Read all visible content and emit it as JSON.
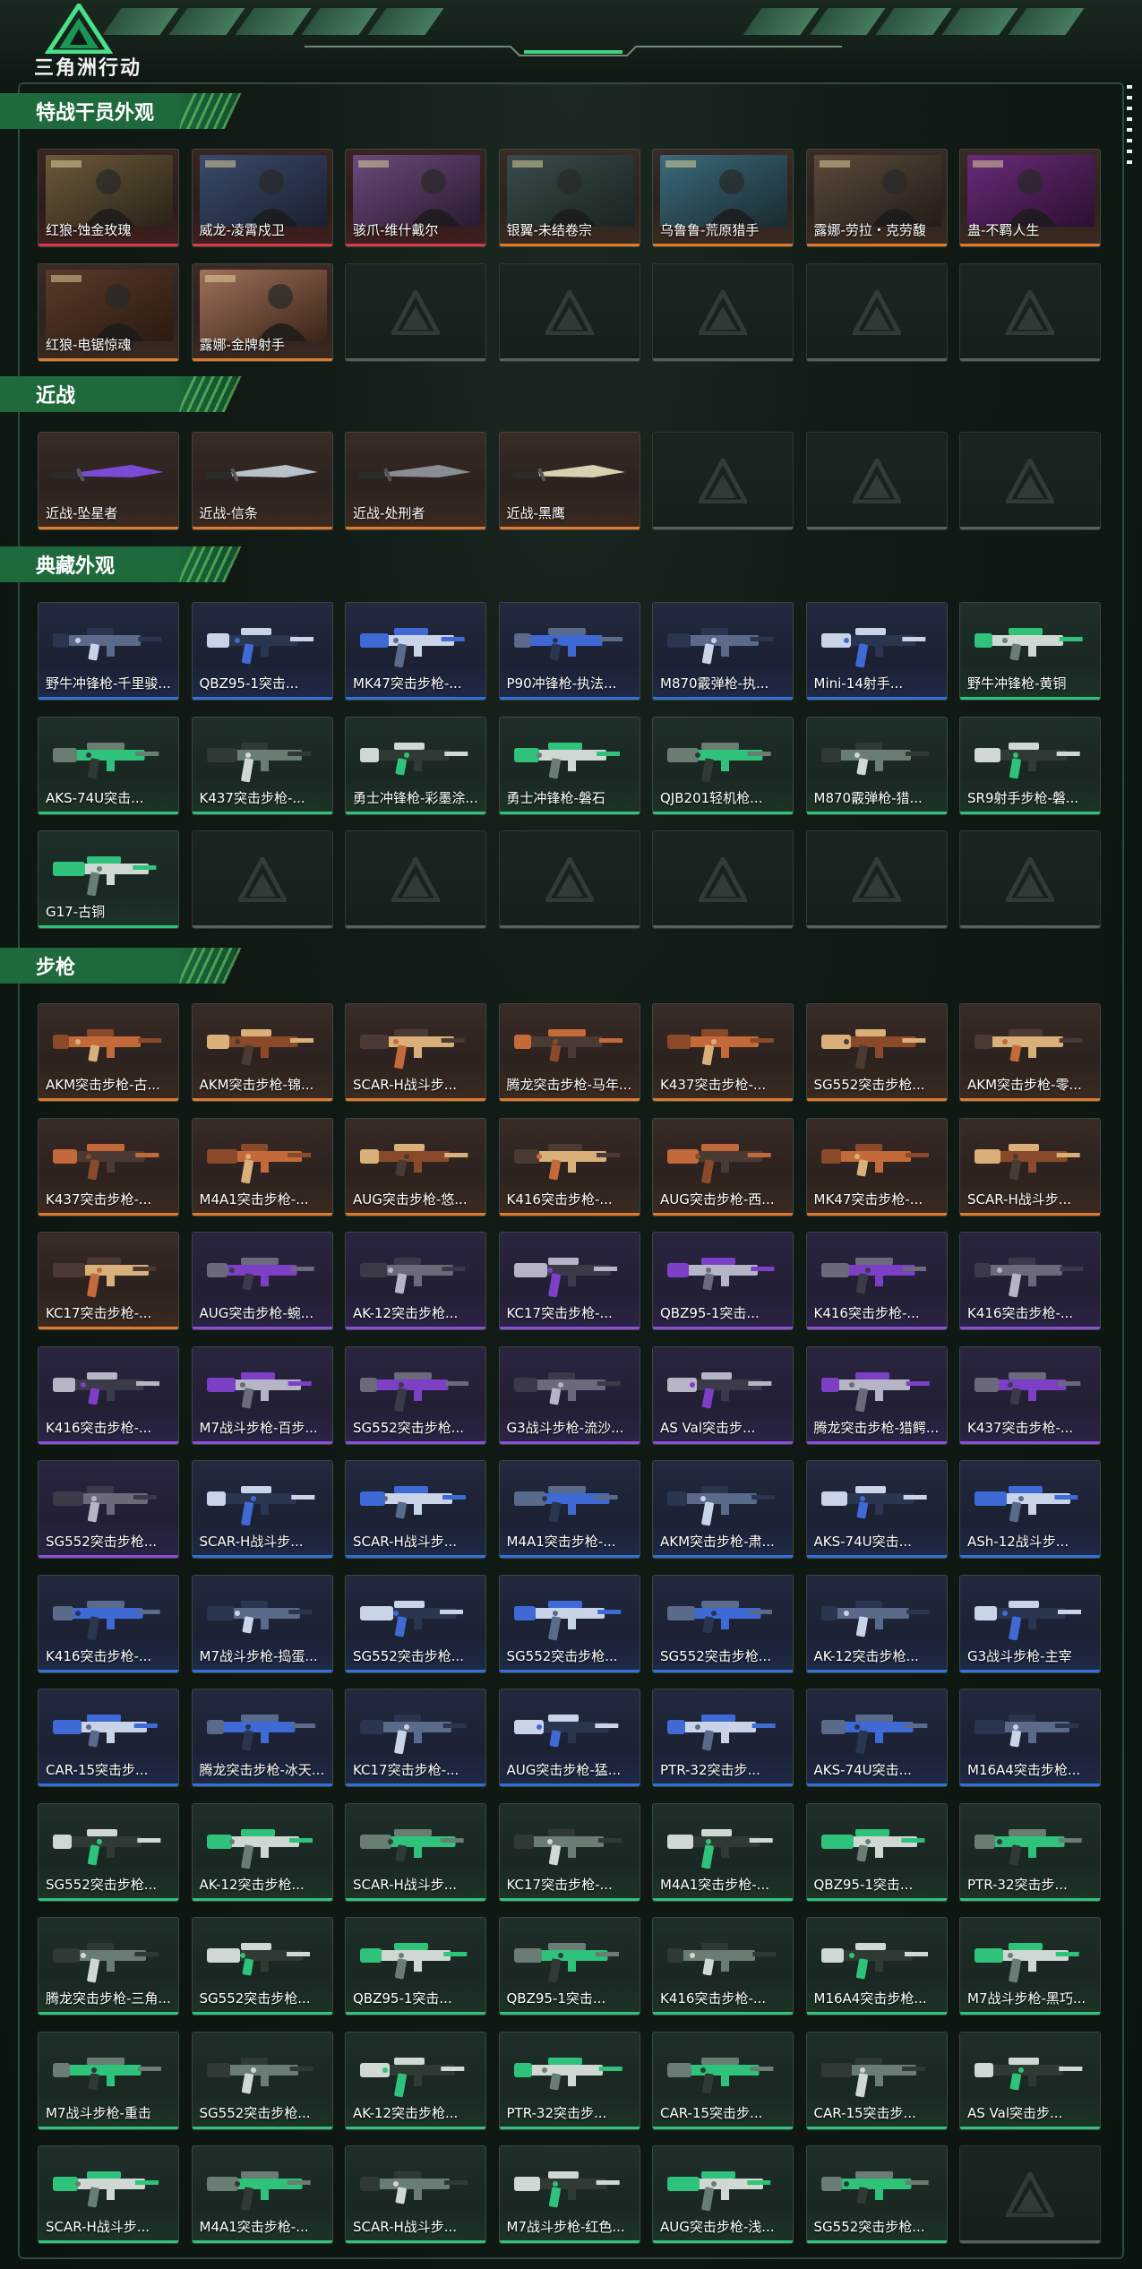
{
  "header": {
    "logo_text": "三角洲行动"
  },
  "colors": {
    "accent": "#1f6a3c",
    "rarity_gold": "#e07a2a",
    "rarity_red": "#d8394a",
    "rarity_purple": "#8f4cd8",
    "rarity_blue": "#3470d6",
    "rarity_green": "#2fc27a"
  },
  "sections": [
    {
      "title": "特战干员外观",
      "kind": "operator",
      "items": [
        {
          "label": "红狼-蚀金玫瑰",
          "rarity": "red"
        },
        {
          "label": "威龙-凌霄戍卫",
          "rarity": "red"
        },
        {
          "label": "骇爪-维什戴尔",
          "rarity": "red"
        },
        {
          "label": "银翼-未结卷宗",
          "rarity": "gold"
        },
        {
          "label": "乌鲁鲁-荒原猎手",
          "rarity": "gold"
        },
        {
          "label": "露娜-劳拉・克劳馥",
          "rarity": "gold"
        },
        {
          "label": "蛊-不羁人生",
          "rarity": "gold"
        },
        {
          "label": "红狼-电锯惊魂",
          "rarity": "gold"
        },
        {
          "label": "露娜-金牌射手",
          "rarity": "gold"
        },
        {
          "label": "",
          "rarity": "empty"
        },
        {
          "label": "",
          "rarity": "empty"
        },
        {
          "label": "",
          "rarity": "empty"
        },
        {
          "label": "",
          "rarity": "empty"
        },
        {
          "label": "",
          "rarity": "empty"
        }
      ]
    },
    {
      "title": "近战",
      "kind": "melee",
      "items": [
        {
          "label": "近战-坠星者",
          "rarity": "gold"
        },
        {
          "label": "近战-信条",
          "rarity": "gold"
        },
        {
          "label": "近战-处刑者",
          "rarity": "gold"
        },
        {
          "label": "近战-黑鹰",
          "rarity": "gold"
        },
        {
          "label": "",
          "rarity": "empty"
        },
        {
          "label": "",
          "rarity": "empty"
        },
        {
          "label": "",
          "rarity": "empty"
        }
      ]
    },
    {
      "title": "典藏外观",
      "kind": "weapon",
      "items": [
        {
          "label": "野牛冲锋枪-千里骏...",
          "rarity": "blue"
        },
        {
          "label": "QBZ95-1突击...",
          "rarity": "blue"
        },
        {
          "label": "MK47突击步枪-...",
          "rarity": "blue"
        },
        {
          "label": "P90冲锋枪-执法...",
          "rarity": "blue"
        },
        {
          "label": "M870霰弹枪-执...",
          "rarity": "blue"
        },
        {
          "label": "Mini-14射手...",
          "rarity": "blue"
        },
        {
          "label": "野牛冲锋枪-黄铜",
          "rarity": "green"
        },
        {
          "label": "AKS-74U突击...",
          "rarity": "green"
        },
        {
          "label": "K437突击步枪-...",
          "rarity": "green"
        },
        {
          "label": "勇士冲锋枪-彩墨涂...",
          "rarity": "green"
        },
        {
          "label": "勇士冲锋枪-磐石",
          "rarity": "green"
        },
        {
          "label": "QJB201轻机枪...",
          "rarity": "green"
        },
        {
          "label": "M870霰弹枪-猎...",
          "rarity": "green"
        },
        {
          "label": "SR9射手步枪-磐...",
          "rarity": "green"
        },
        {
          "label": "G17-古铜",
          "rarity": "green"
        },
        {
          "label": "",
          "rarity": "empty"
        },
        {
          "label": "",
          "rarity": "empty"
        },
        {
          "label": "",
          "rarity": "empty"
        },
        {
          "label": "",
          "rarity": "empty"
        },
        {
          "label": "",
          "rarity": "empty"
        },
        {
          "label": "",
          "rarity": "empty"
        }
      ]
    },
    {
      "title": "步枪",
      "kind": "weapon",
      "items": [
        {
          "label": "AKM突击步枪-古...",
          "rarity": "gold"
        },
        {
          "label": "AKM突击步枪-锦...",
          "rarity": "gold"
        },
        {
          "label": "SCAR-H战斗步...",
          "rarity": "gold"
        },
        {
          "label": "腾龙突击步枪-马年...",
          "rarity": "gold"
        },
        {
          "label": "K437突击步枪-...",
          "rarity": "gold"
        },
        {
          "label": "SG552突击步枪...",
          "rarity": "gold"
        },
        {
          "label": "AKM突击步枪-零...",
          "rarity": "gold"
        },
        {
          "label": "K437突击步枪-...",
          "rarity": "gold"
        },
        {
          "label": "M4A1突击步枪-...",
          "rarity": "gold"
        },
        {
          "label": "AUG突击步枪-悠...",
          "rarity": "gold"
        },
        {
          "label": "K416突击步枪-...",
          "rarity": "gold"
        },
        {
          "label": "AUG突击步枪-西...",
          "rarity": "gold"
        },
        {
          "label": "MK47突击步枪-...",
          "rarity": "gold"
        },
        {
          "label": "SCAR-H战斗步...",
          "rarity": "gold"
        },
        {
          "label": "KC17突击步枪-...",
          "rarity": "gold"
        },
        {
          "label": "AUG突击步枪-蜿...",
          "rarity": "purple"
        },
        {
          "label": "AK-12突击步枪...",
          "rarity": "purple"
        },
        {
          "label": "KC17突击步枪-...",
          "rarity": "purple"
        },
        {
          "label": "QBZ95-1突击...",
          "rarity": "purple"
        },
        {
          "label": "K416突击步枪-...",
          "rarity": "purple"
        },
        {
          "label": "K416突击步枪-...",
          "rarity": "purple"
        },
        {
          "label": "K416突击步枪-...",
          "rarity": "purple"
        },
        {
          "label": "M7战斗步枪-百步...",
          "rarity": "purple"
        },
        {
          "label": "SG552突击步枪...",
          "rarity": "purple"
        },
        {
          "label": "G3战斗步枪-流沙...",
          "rarity": "purple"
        },
        {
          "label": "AS Val突击步...",
          "rarity": "purple"
        },
        {
          "label": "腾龙突击步枪-猎鳄...",
          "rarity": "purple"
        },
        {
          "label": "K437突击步枪-...",
          "rarity": "purple"
        },
        {
          "label": "SG552突击步枪...",
          "rarity": "purple"
        },
        {
          "label": "SCAR-H战斗步...",
          "rarity": "blue"
        },
        {
          "label": "SCAR-H战斗步...",
          "rarity": "blue"
        },
        {
          "label": "M4A1突击步枪-...",
          "rarity": "blue"
        },
        {
          "label": "AKM突击步枪-肃...",
          "rarity": "blue"
        },
        {
          "label": "AKS-74U突击...",
          "rarity": "blue"
        },
        {
          "label": "ASh-12战斗步...",
          "rarity": "blue"
        },
        {
          "label": "K416突击步枪-...",
          "rarity": "blue"
        },
        {
          "label": "M7战斗步枪-捣蛋...",
          "rarity": "blue"
        },
        {
          "label": "SG552突击步枪...",
          "rarity": "blue"
        },
        {
          "label": "SG552突击步枪...",
          "rarity": "blue"
        },
        {
          "label": "SG552突击步枪...",
          "rarity": "blue"
        },
        {
          "label": "AK-12突击步枪...",
          "rarity": "blue"
        },
        {
          "label": "G3战斗步枪-主宰",
          "rarity": "blue"
        },
        {
          "label": "CAR-15突击步...",
          "rarity": "blue"
        },
        {
          "label": "腾龙突击步枪-冰天...",
          "rarity": "blue"
        },
        {
          "label": "KC17突击步枪-...",
          "rarity": "blue"
        },
        {
          "label": "AUG突击步枪-猛...",
          "rarity": "blue"
        },
        {
          "label": "PTR-32突击步...",
          "rarity": "blue"
        },
        {
          "label": "AKS-74U突击...",
          "rarity": "blue"
        },
        {
          "label": "M16A4突击步枪...",
          "rarity": "blue"
        },
        {
          "label": "SG552突击步枪...",
          "rarity": "green"
        },
        {
          "label": "AK-12突击步枪...",
          "rarity": "green"
        },
        {
          "label": "SCAR-H战斗步...",
          "rarity": "green"
        },
        {
          "label": "KC17突击步枪-...",
          "rarity": "green"
        },
        {
          "label": "M4A1突击步枪-...",
          "rarity": "green"
        },
        {
          "label": "QBZ95-1突击...",
          "rarity": "green"
        },
        {
          "label": "PTR-32突击步...",
          "rarity": "green"
        },
        {
          "label": "腾龙突击步枪-三角...",
          "rarity": "green"
        },
        {
          "label": "SG552突击步枪...",
          "rarity": "green"
        },
        {
          "label": "QBZ95-1突击...",
          "rarity": "green"
        },
        {
          "label": "QBZ95-1突击...",
          "rarity": "green"
        },
        {
          "label": "K416突击步枪-...",
          "rarity": "green"
        },
        {
          "label": "M16A4突击步枪...",
          "rarity": "green"
        },
        {
          "label": "M7战斗步枪-黑巧...",
          "rarity": "green"
        },
        {
          "label": "M7战斗步枪-重击",
          "rarity": "green"
        },
        {
          "label": "SG552突击步枪...",
          "rarity": "green"
        },
        {
          "label": "AK-12突击步枪...",
          "rarity": "green"
        },
        {
          "label": "PTR-32突击步...",
          "rarity": "green"
        },
        {
          "label": "CAR-15突击步...",
          "rarity": "green"
        },
        {
          "label": "CAR-15突击步...",
          "rarity": "green"
        },
        {
          "label": "AS Val突击步...",
          "rarity": "green"
        },
        {
          "label": "SCAR-H战斗步...",
          "rarity": "green"
        },
        {
          "label": "M4A1突击步枪-...",
          "rarity": "green"
        },
        {
          "label": "SCAR-H战斗步...",
          "rarity": "green"
        },
        {
          "label": "M7战斗步枪-红色...",
          "rarity": "green"
        },
        {
          "label": "AUG突击步枪-浅...",
          "rarity": "green"
        },
        {
          "label": "SG552突击步枪...",
          "rarity": "green"
        },
        {
          "label": "",
          "rarity": "empty"
        }
      ]
    }
  ]
}
